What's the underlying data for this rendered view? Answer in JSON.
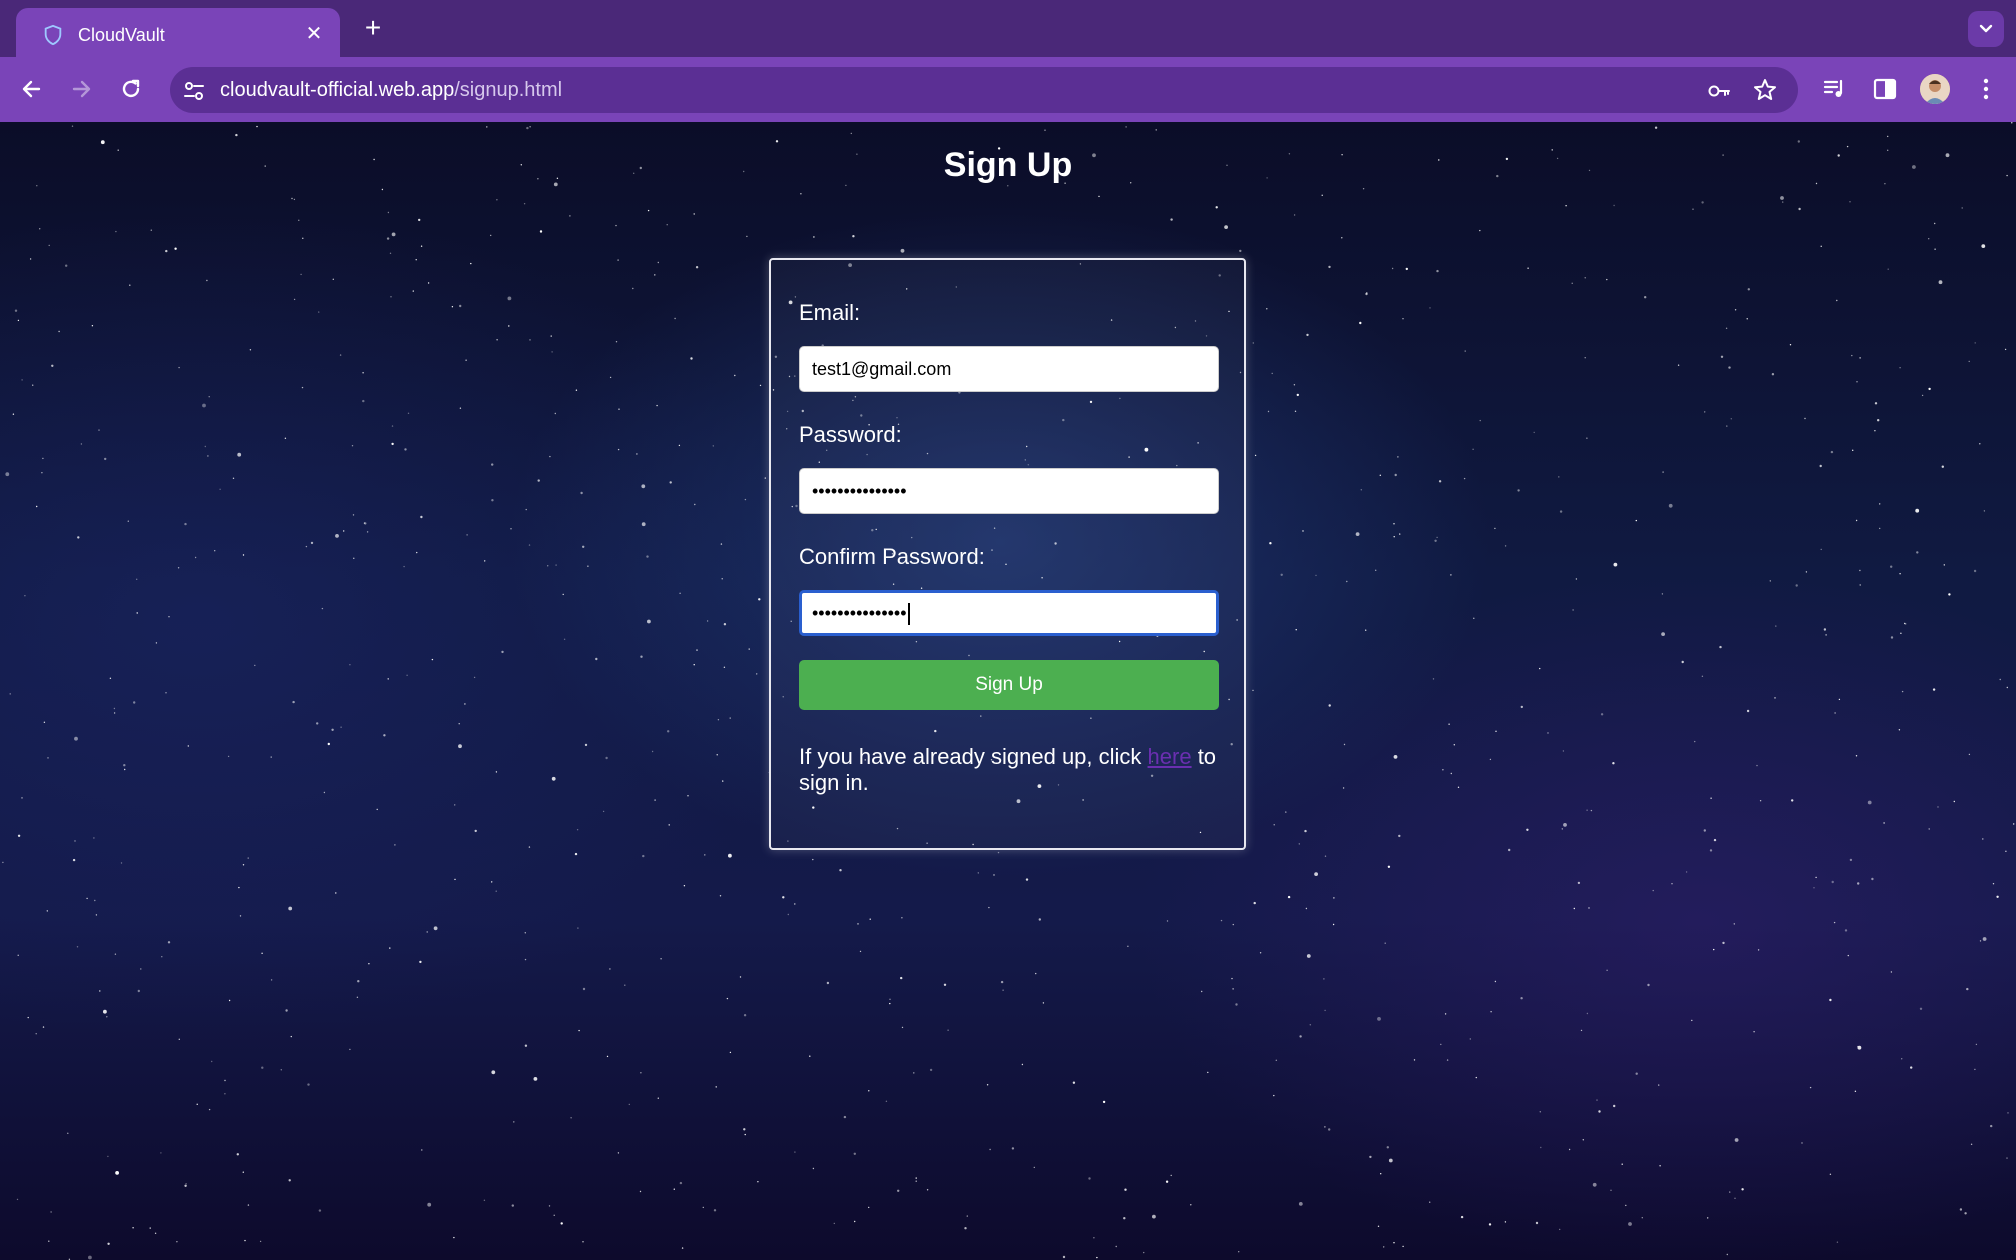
{
  "browser": {
    "tab_title": "CloudVault",
    "url_host": "cloudvault-official.web.app",
    "url_path": "/signup.html",
    "accent_color": "#7a44b8"
  },
  "page": {
    "title": "Sign Up"
  },
  "form": {
    "email_label": "Email:",
    "email_value": "test1@gmail.com",
    "password_label": "Password:",
    "password_value": "•••••••••••••••",
    "confirm_label": "Confirm Password:",
    "confirm_value": "•••••••••••••••",
    "submit_label": "Sign Up",
    "submit_color": "#4caf50",
    "note_prefix": "If you have already signed up, click ",
    "note_link": "here",
    "note_suffix": " to sign in."
  }
}
